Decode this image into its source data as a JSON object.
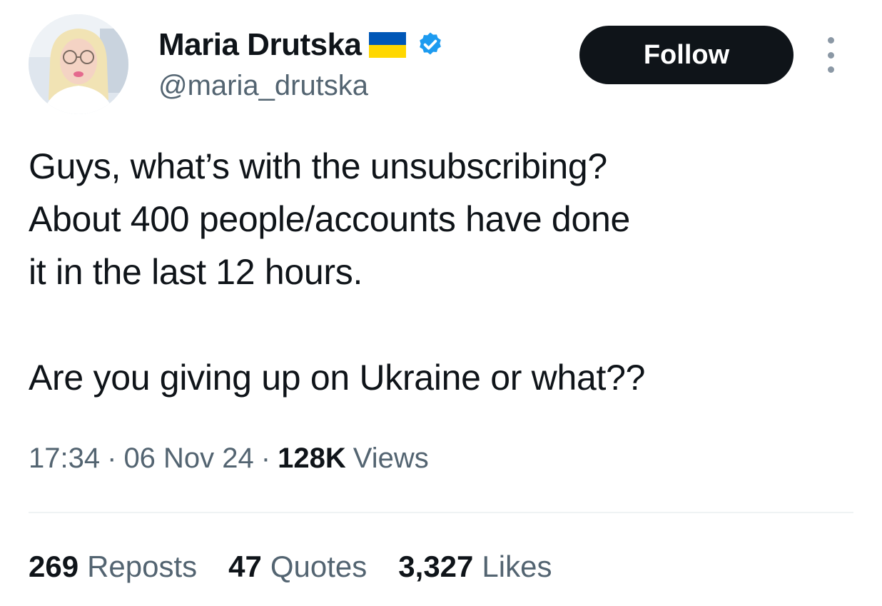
{
  "author": {
    "display_name": "Maria Drutska",
    "handle": "@maria_drutska",
    "flag_icon": "ukraine-flag-icon",
    "verified_icon": "verified-badge-icon",
    "verified_color": "#1d9bf0"
  },
  "actions": {
    "follow_label": "Follow",
    "more_icon": "more-options-icon"
  },
  "tweet": {
    "lines": [
      "Guys, what’s with the unsubscribing?",
      "About 400 people/accounts have done",
      "it in the last 12 hours.",
      "Are you giving up on Ukraine or what??"
    ]
  },
  "meta": {
    "time": "17:34",
    "separator": "·",
    "date": "06 Nov 24",
    "views_count": "128K",
    "views_label": "Views"
  },
  "stats": {
    "reposts_count": "269",
    "reposts_label": "Reposts",
    "quotes_count": "47",
    "quotes_label": "Quotes",
    "likes_count": "3,327",
    "likes_label": "Likes"
  },
  "colors": {
    "text_primary": "#0f1419",
    "text_secondary": "#536471",
    "follow_bg": "#0f1419",
    "flag_blue": "#0057b7",
    "flag_yellow": "#ffd700"
  }
}
